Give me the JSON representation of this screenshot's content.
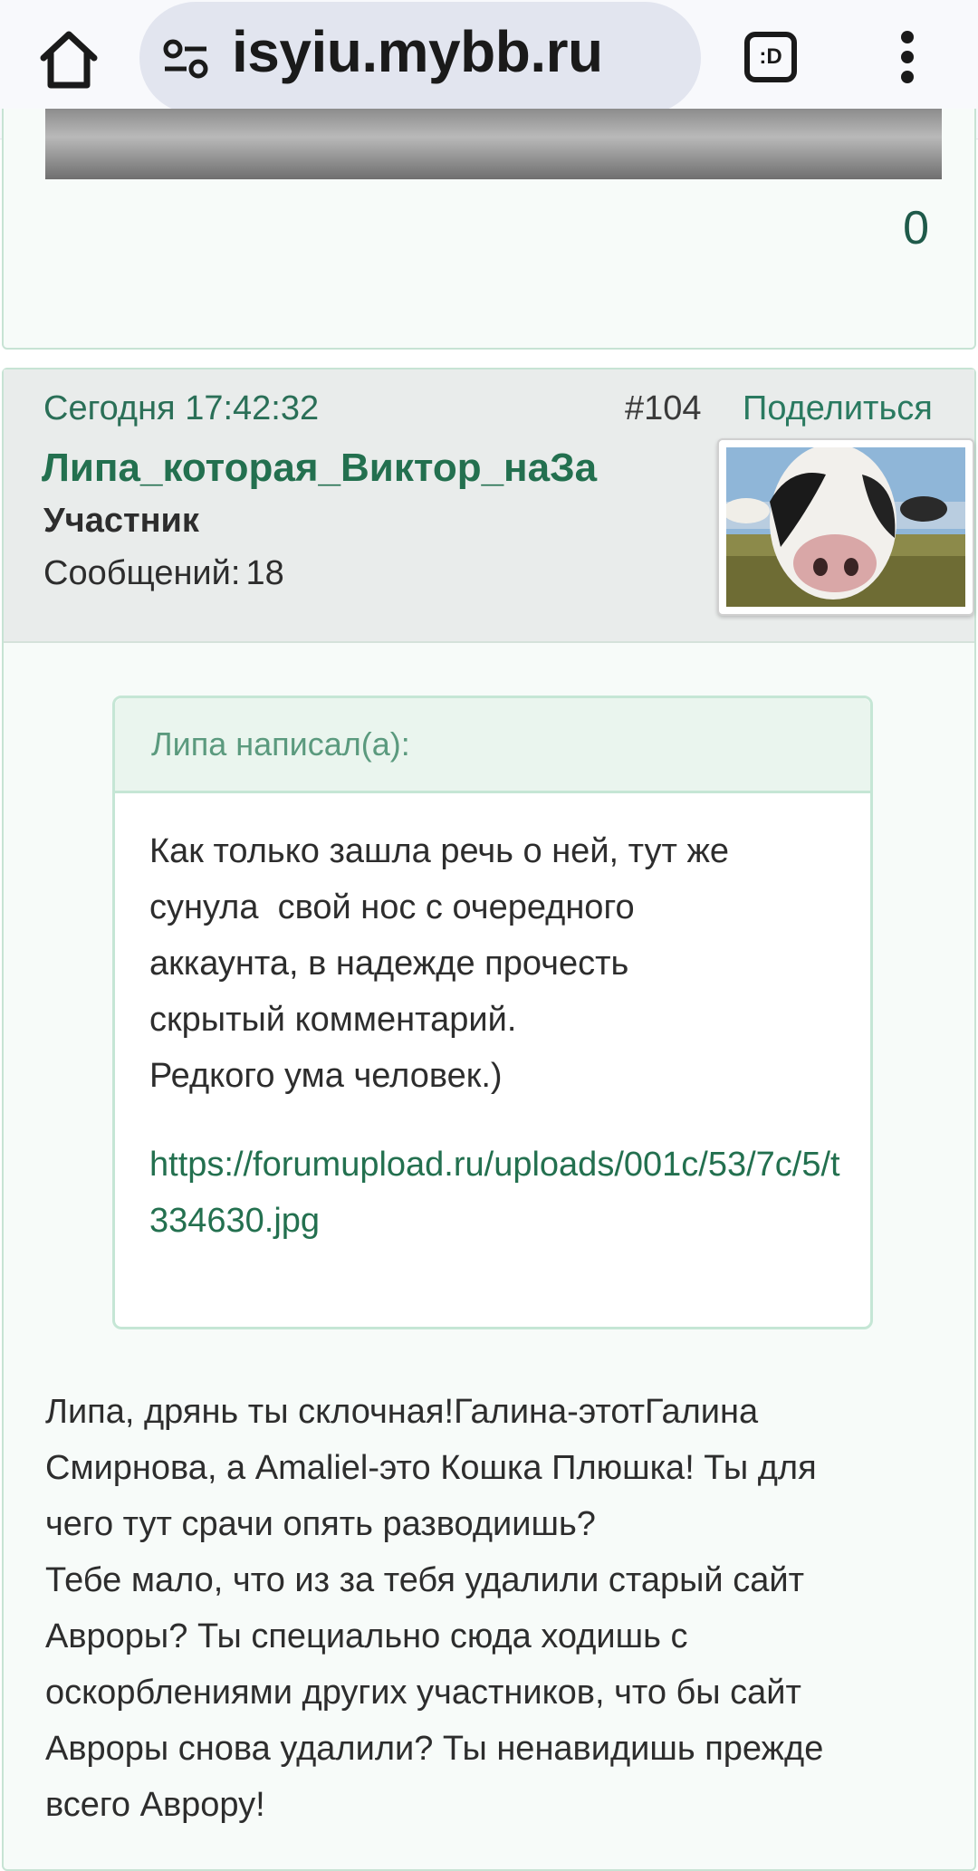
{
  "browser": {
    "url_text": "isyiu.mybb.ru",
    "tabs_label": ":D"
  },
  "prev_post": {
    "count": "0"
  },
  "post": {
    "date": "Сегодня 17:42:32",
    "number": "#104",
    "share_label": "Поделиться",
    "author": "Липа_которая_Виктор_наЗа",
    "role": "Участник",
    "messages_label": "Сообщений:",
    "messages_count": "18",
    "quote": {
      "author_line": "Липа написал(а):",
      "text": "Как только зашла речь о ней, тут же\nсунула  свой нос с очередного\nаккаунта, в надежде прочесть\nскрытый комментарий.\nРедкого ума человек.)",
      "link": "https://forumupload.ru/uploads/001c/53/7c/5/t334630.jpg"
    },
    "body": "Липа, дрянь ты склочная!Галина-этотГалина\nСмирнова, а Amaliel-это Кошка Плюшка! Ты для\nчего тут срачи опять разводиишь?\nТебе мало, что из за тебя удалили старый сайт\nАвроры? Ты специально сюда ходишь с\nоскорблениями других участников, что бы сайт\nАвроры снова удалили? Ты ненавидишь прежде\nвсего Аврору!"
  },
  "colors": {
    "accent": "#23704f",
    "quote_border": "#c5e6d5",
    "header_bg": "#e9eceb"
  }
}
